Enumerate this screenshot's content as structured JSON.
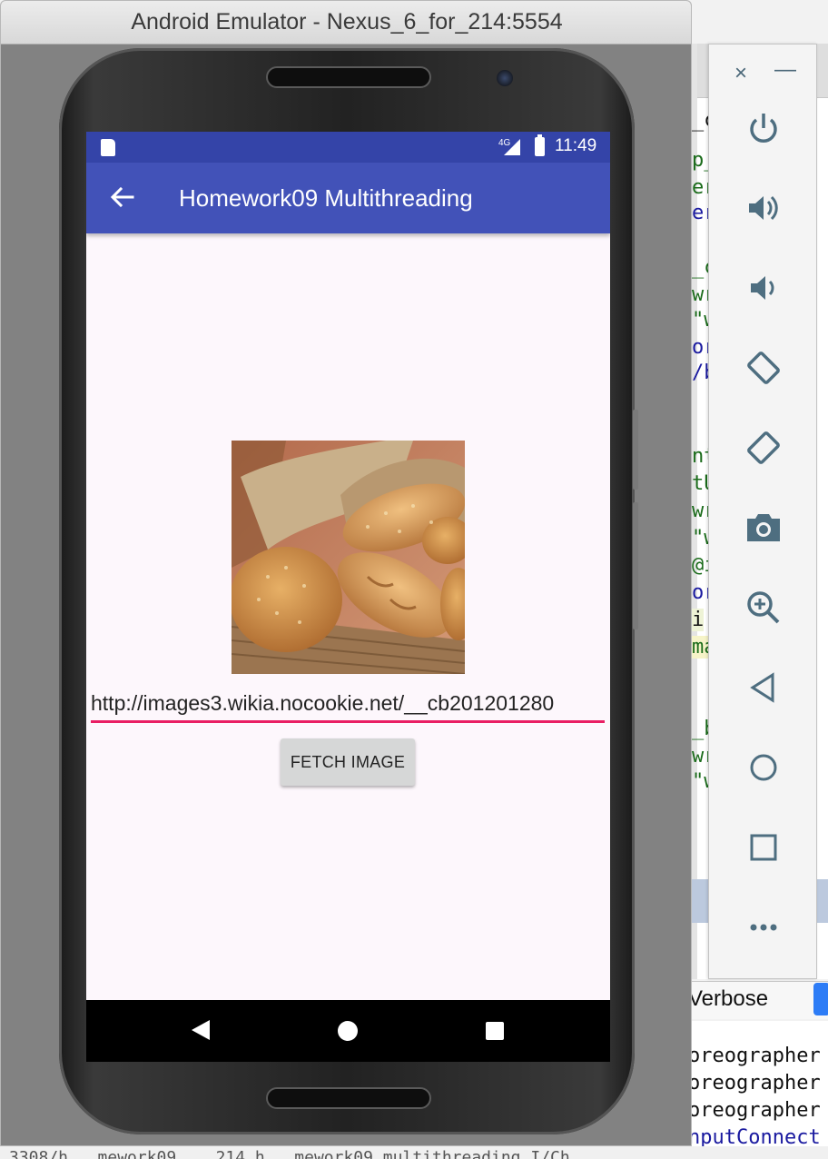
{
  "window": {
    "title": "Android Emulator - Nexus_6_for_214:5554"
  },
  "status_bar": {
    "network": "4G",
    "time": "11:49"
  },
  "app_bar": {
    "title": "Homework09 Multithreading"
  },
  "url_input": {
    "value": "http://images3.wikia.nocookie.net/__cb201201280"
  },
  "fetch_button": {
    "label": "FETCH IMAGE"
  },
  "toolbar": {
    "close": "×",
    "minimize": "—",
    "items": [
      "power-icon",
      "volume-up-icon",
      "volume-down-icon",
      "rotate-left-icon",
      "rotate-right-icon",
      "camera-icon",
      "zoom-icon",
      "back-icon",
      "home-icon",
      "overview-icon",
      "more-icon"
    ]
  },
  "ide": {
    "verbose_label": "Verbose",
    "code_lines": [
      "_c",
      "p_",
      "er",
      "_c",
      "wr",
      "\"w",
      "or",
      "/b",
      "nt",
      "tU",
      "wr",
      "\"w",
      "@i",
      "or",
      "i",
      "ma",
      "_b",
      "wr",
      "\"w"
    ],
    "log_lines": [
      "oreographer",
      "oreographer",
      "oreographer",
      "nputConnect"
    ],
    "bottom_text": "3308/h...mework09....214 h...mework09 multithreading I/Ch..."
  },
  "colors": {
    "status_bar": "#3444a8",
    "app_bar": "#4252b8",
    "accent": "#e91e63",
    "screen_bg": "#fdf7fc"
  }
}
